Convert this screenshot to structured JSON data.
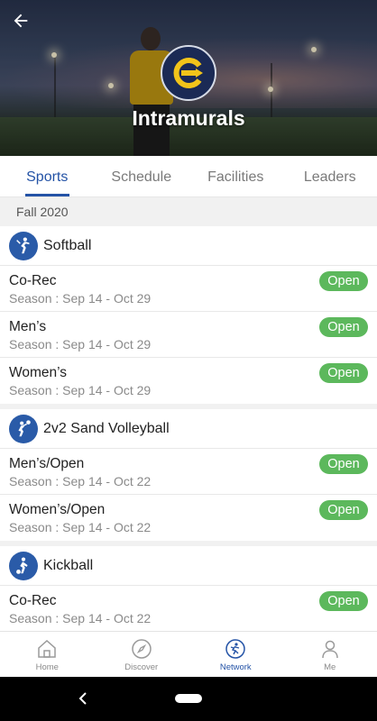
{
  "header": {
    "title": "Intramurals",
    "back_icon": "arrow-left-icon",
    "logo_icon": "school-logo-icon"
  },
  "tabs": [
    {
      "label": "Sports",
      "active": true
    },
    {
      "label": "Schedule",
      "active": false
    },
    {
      "label": "Facilities",
      "active": false
    },
    {
      "label": "Leaders",
      "active": false
    }
  ],
  "season_label": "Fall 2020",
  "sports": [
    {
      "name": "Softball",
      "icon": "softball-player-icon",
      "leagues": [
        {
          "name": "Co-Rec",
          "season": "Season : Sep 14 - Oct 29",
          "status": "Open"
        },
        {
          "name": "Men’s",
          "season": "Season : Sep 14 - Oct 29",
          "status": "Open"
        },
        {
          "name": "Women’s",
          "season": "Season : Sep 14 - Oct 29",
          "status": "Open"
        }
      ]
    },
    {
      "name": "2v2 Sand Volleyball",
      "icon": "volleyball-player-icon",
      "leagues": [
        {
          "name": "Men’s/Open",
          "season": "Season : Sep 14 - Oct 22",
          "status": "Open"
        },
        {
          "name": "Women’s/Open",
          "season": "Season : Sep 14 - Oct 22",
          "status": "Open"
        }
      ]
    },
    {
      "name": "Kickball",
      "icon": "kickball-player-icon",
      "leagues": [
        {
          "name": "Co-Rec",
          "season": "Season : Sep 14 - Oct 22",
          "status": "Open"
        }
      ]
    }
  ],
  "bottom_nav": [
    {
      "label": "Home",
      "icon": "home-icon",
      "active": false
    },
    {
      "label": "Discover",
      "icon": "compass-icon",
      "active": false
    },
    {
      "label": "Network",
      "icon": "network-icon",
      "active": true
    },
    {
      "label": "Me",
      "icon": "person-icon",
      "active": false
    }
  ],
  "colors": {
    "accent": "#2453a6",
    "open_badge": "#5cb85c",
    "sport_icon_bg": "#2a5ba8"
  }
}
